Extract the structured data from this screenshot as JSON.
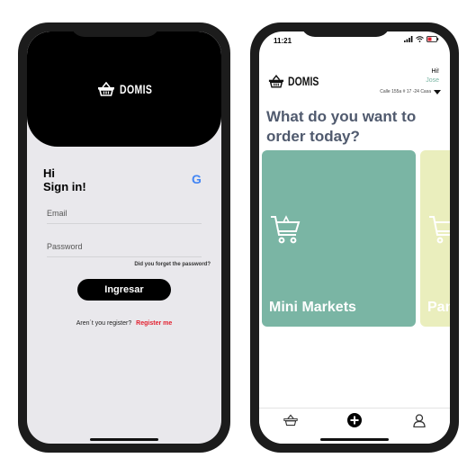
{
  "login": {
    "brand": "DOMIS",
    "greeting_line1": "Hi",
    "greeting_line2": "Sign in!",
    "google_glyph": "G",
    "email_placeholder": "Email",
    "password_placeholder": "Password",
    "forgot": "Did you forget the password?",
    "submit": "Ingresar",
    "register_prompt": "Aren´t you register?",
    "register_link": "Register me"
  },
  "home": {
    "time": "11:21",
    "brand": "DOMIS",
    "hi": "Hi!",
    "user": "Jose",
    "address": "Calle 155a # 17 -24 Casa",
    "question": "What do you want to order today?",
    "categories": [
      {
        "label": "Mini Markets",
        "color": "#7ab5a4"
      },
      {
        "label": "Pan",
        "color": "#eaeebd"
      }
    ],
    "tabs": [
      {
        "icon": "basket-icon"
      },
      {
        "icon": "plus-circle-icon"
      },
      {
        "icon": "user-icon"
      }
    ]
  },
  "colors": {
    "accent_green": "#7ab5a4",
    "register_red": "#e3202f",
    "heading_slate": "#505a6e"
  }
}
